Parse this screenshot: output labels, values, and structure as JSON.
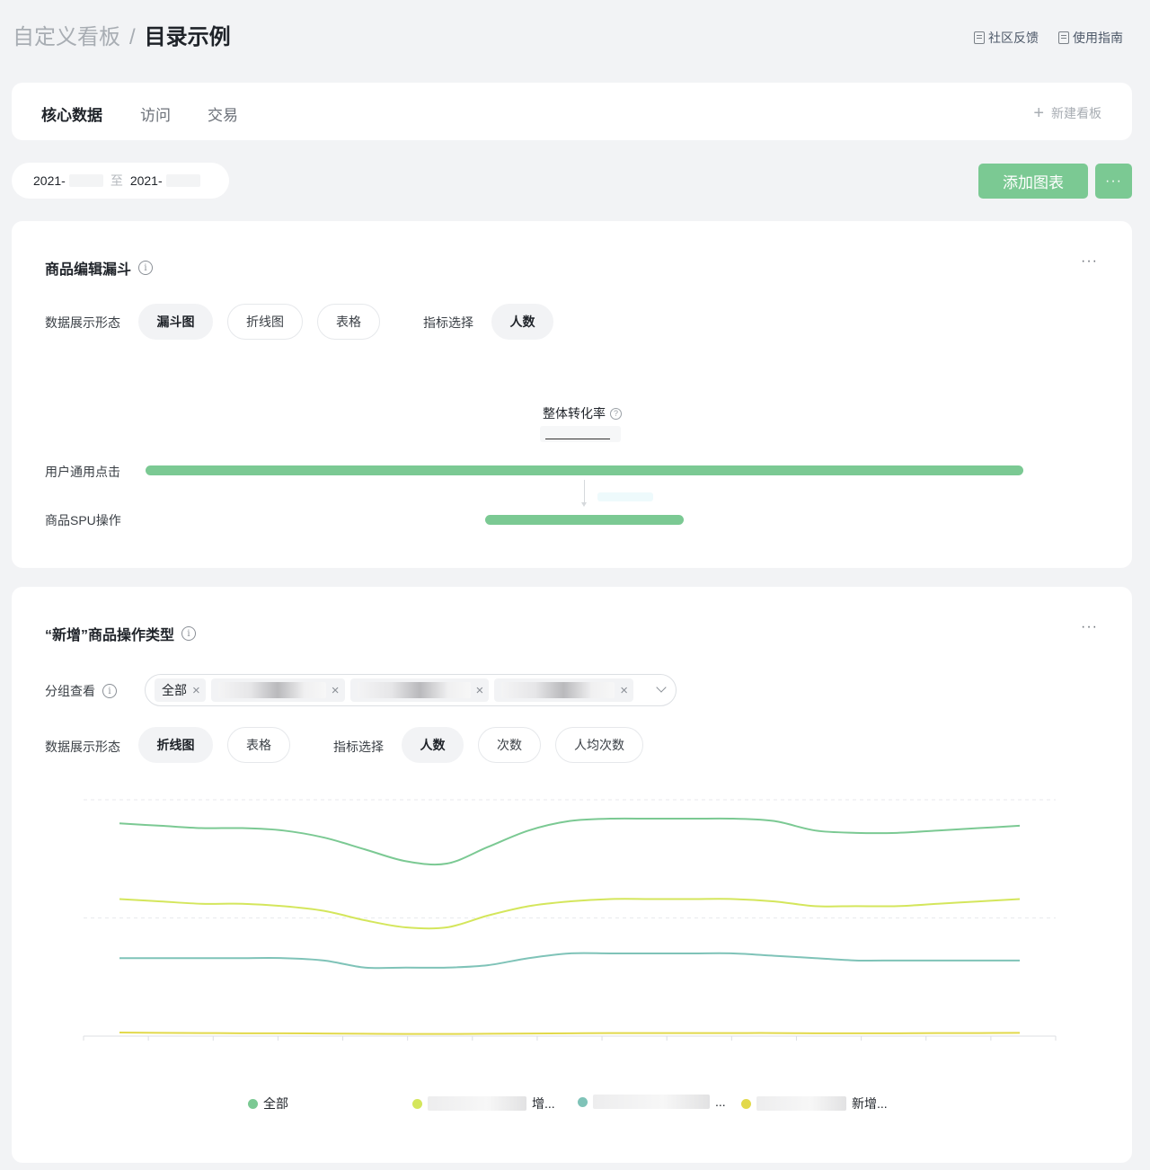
{
  "header": {
    "breadcrumb_parent": "自定义看板",
    "breadcrumb_sep": "/",
    "breadcrumb_current": "目录示例",
    "links": [
      "社区反馈",
      "使用指南"
    ]
  },
  "tabs": [
    "核心数据",
    "访问",
    "交易"
  ],
  "new_board": "新建看板",
  "date_range": {
    "start": "2021-",
    "to": "至",
    "end": "2021-"
  },
  "actions": {
    "add_chart": "添加图表",
    "more": "···"
  },
  "funnel_card": {
    "title": "商品编辑漏斗",
    "display_label": "数据展示形态",
    "display_options": [
      "漏斗图",
      "折线图",
      "表格"
    ],
    "display_selected": "漏斗图",
    "metric_label": "指标选择",
    "metric_options": [
      "人数"
    ],
    "metric_selected": "人数",
    "conversion_label": "整体转化率",
    "steps": [
      {
        "name": "用户通用点击",
        "ratio": 1.0
      },
      {
        "name": "商品SPU操作",
        "ratio": 0.226
      }
    ]
  },
  "line_card": {
    "title": "“新增”商品操作类型",
    "group_label": "分组查看",
    "group_tags": [
      "全部",
      "",
      "",
      ""
    ],
    "display_label": "数据展示形态",
    "display_options": [
      "折线图",
      "表格"
    ],
    "display_selected": "折线图",
    "metric_label": "指标选择",
    "metric_options": [
      "人数",
      "次数",
      "人均次数"
    ],
    "metric_selected": "人数",
    "legend": [
      {
        "name": "全部",
        "color": "#7bc993"
      },
      {
        "name": "增...",
        "color": "#d4e65c"
      },
      {
        "name": "...",
        "color": "#7fc3b8"
      },
      {
        "name": "新增...",
        "color": "#e2d94b"
      }
    ]
  },
  "chart_data": {
    "type": "line",
    "x": [
      0,
      1,
      2,
      3,
      4,
      5,
      6,
      7,
      8,
      9,
      10,
      11,
      12,
      13,
      14,
      15,
      16,
      17,
      18,
      19,
      20,
      21,
      22
    ],
    "ylim": [
      0,
      100
    ],
    "grid": true,
    "legend_position": "bottom",
    "series": [
      {
        "name": "全部",
        "color": "#7bc993",
        "values": [
          90,
          89,
          88,
          88,
          87,
          84,
          79,
          74,
          73,
          80,
          87,
          91,
          92,
          92,
          92,
          92,
          91,
          87,
          86,
          86,
          87,
          88,
          89
        ]
      },
      {
        "name": "增...",
        "color": "#d4e65c",
        "values": [
          58,
          57,
          56,
          56,
          55,
          53,
          49,
          46,
          46,
          51,
          55,
          57,
          58,
          58,
          58,
          58,
          57,
          55,
          55,
          55,
          56,
          57,
          58
        ]
      },
      {
        "name": "...",
        "color": "#7fc3b8",
        "values": [
          33,
          33,
          33,
          33,
          33,
          32,
          29,
          29,
          29,
          30,
          33,
          35,
          35,
          35,
          35,
          35,
          34,
          33,
          32,
          32,
          32,
          32,
          32
        ]
      },
      {
        "name": "新增...",
        "color": "#e2d94b",
        "values": [
          1.5,
          1.4,
          1.3,
          1.2,
          1.2,
          1.1,
          1.0,
          0.9,
          0.9,
          1.0,
          1.1,
          1.2,
          1.3,
          1.3,
          1.3,
          1.3,
          1.3,
          1.2,
          1.2,
          1.2,
          1.3,
          1.3,
          1.4
        ]
      }
    ]
  }
}
